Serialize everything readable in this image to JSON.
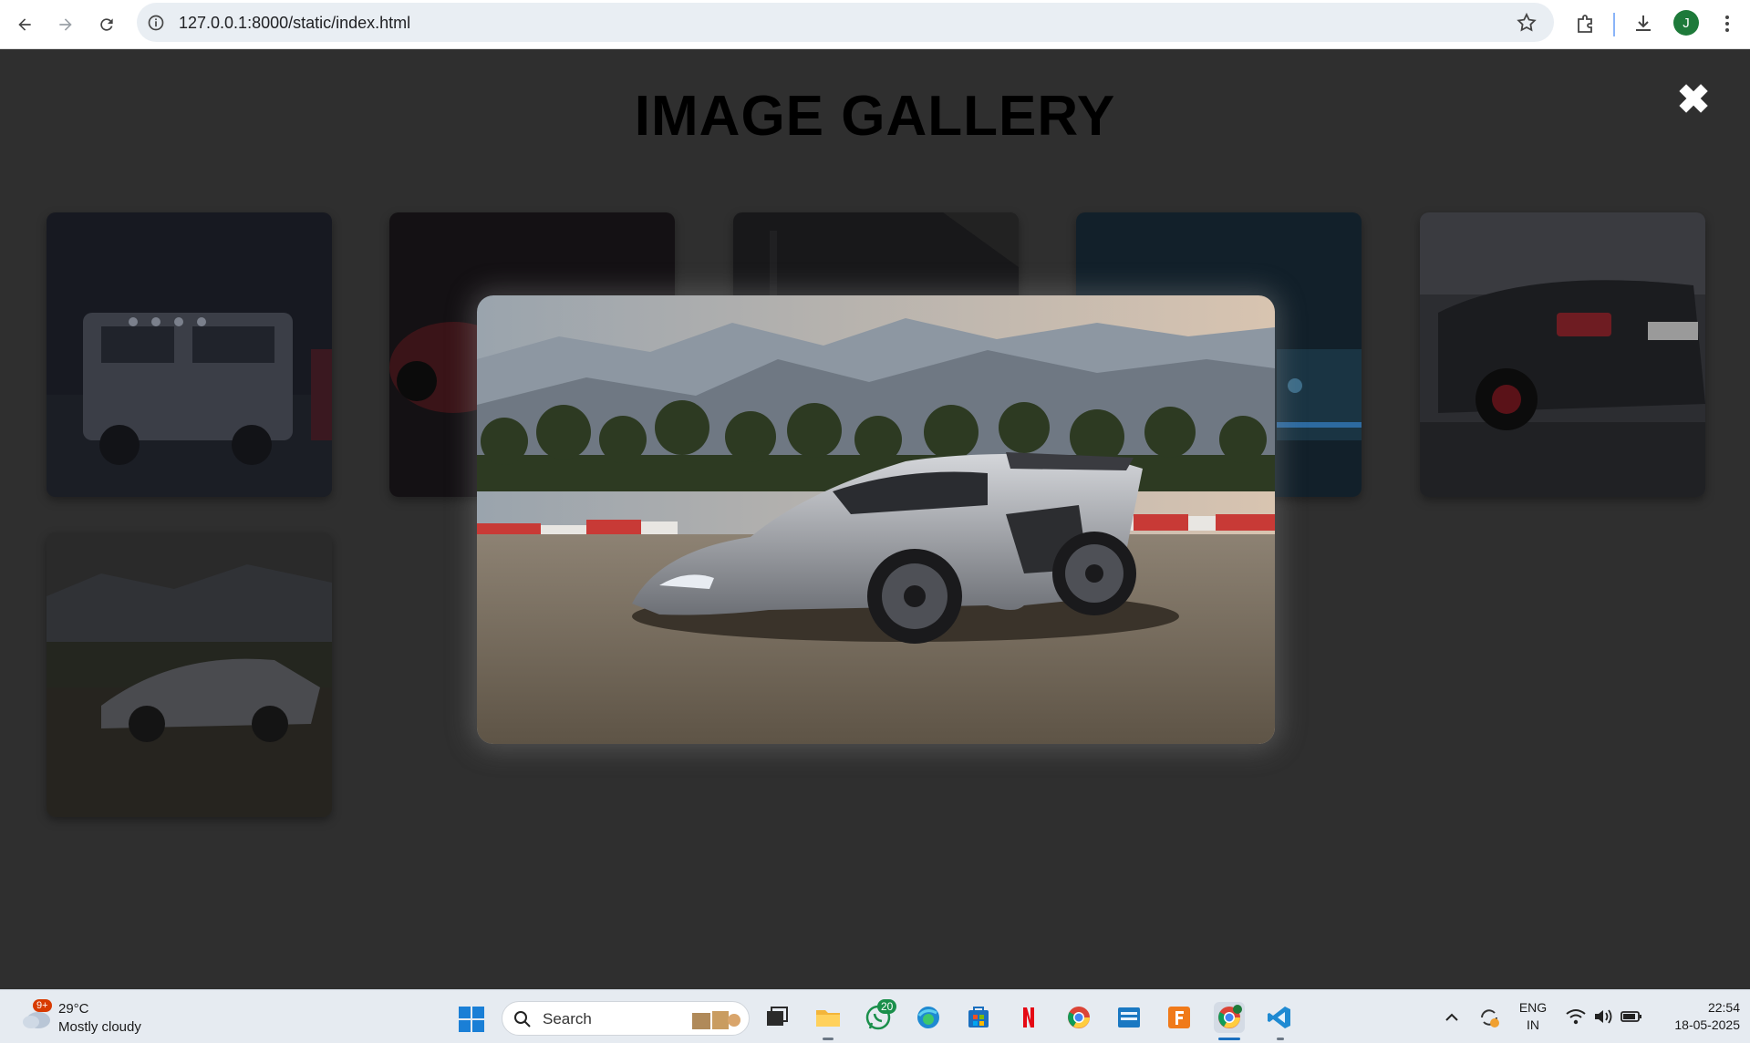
{
  "browser": {
    "url": "127.0.0.1:8000/static/index.html",
    "avatar_letter": "J",
    "icons": [
      "back-icon",
      "forward-icon",
      "reload-icon",
      "site-info-icon",
      "bookmark-star-icon",
      "extensions-icon",
      "downloads-icon",
      "menu-icon"
    ]
  },
  "page": {
    "title": "IMAGE GALLERY",
    "close_symbol": "✖",
    "background": "#2f2f2f",
    "thumbnails": [
      {
        "subject": "white G-class SUV at night"
      },
      {
        "subject": "red sports car in dark"
      },
      {
        "subject": "dark interior car shot"
      },
      {
        "subject": "blue-lit car at night"
      },
      {
        "subject": "black Mercedes C-class rear"
      },
      {
        "subject": "silver hypercar desert"
      }
    ],
    "lightbox": {
      "subject": "silver hypercar in desert with palm trees and mountains"
    }
  },
  "taskbar": {
    "weather": {
      "badge": "9+",
      "temp": "29°C",
      "condition": "Mostly cloudy"
    },
    "search_placeholder": "Search",
    "whatsapp_badge": "20",
    "lang_line1": "ENG",
    "lang_line2": "IN",
    "time": "22:54",
    "date": "18-05-2025",
    "apps": [
      "start-icon",
      "task-view-icon",
      "file-explorer-icon",
      "whatsapp-icon",
      "edge-icon",
      "store-icon",
      "netflix-icon",
      "chrome-icon",
      "prime-video-icon",
      "fus-app-icon",
      "chrome-profile-icon",
      "vscode-icon"
    ]
  }
}
